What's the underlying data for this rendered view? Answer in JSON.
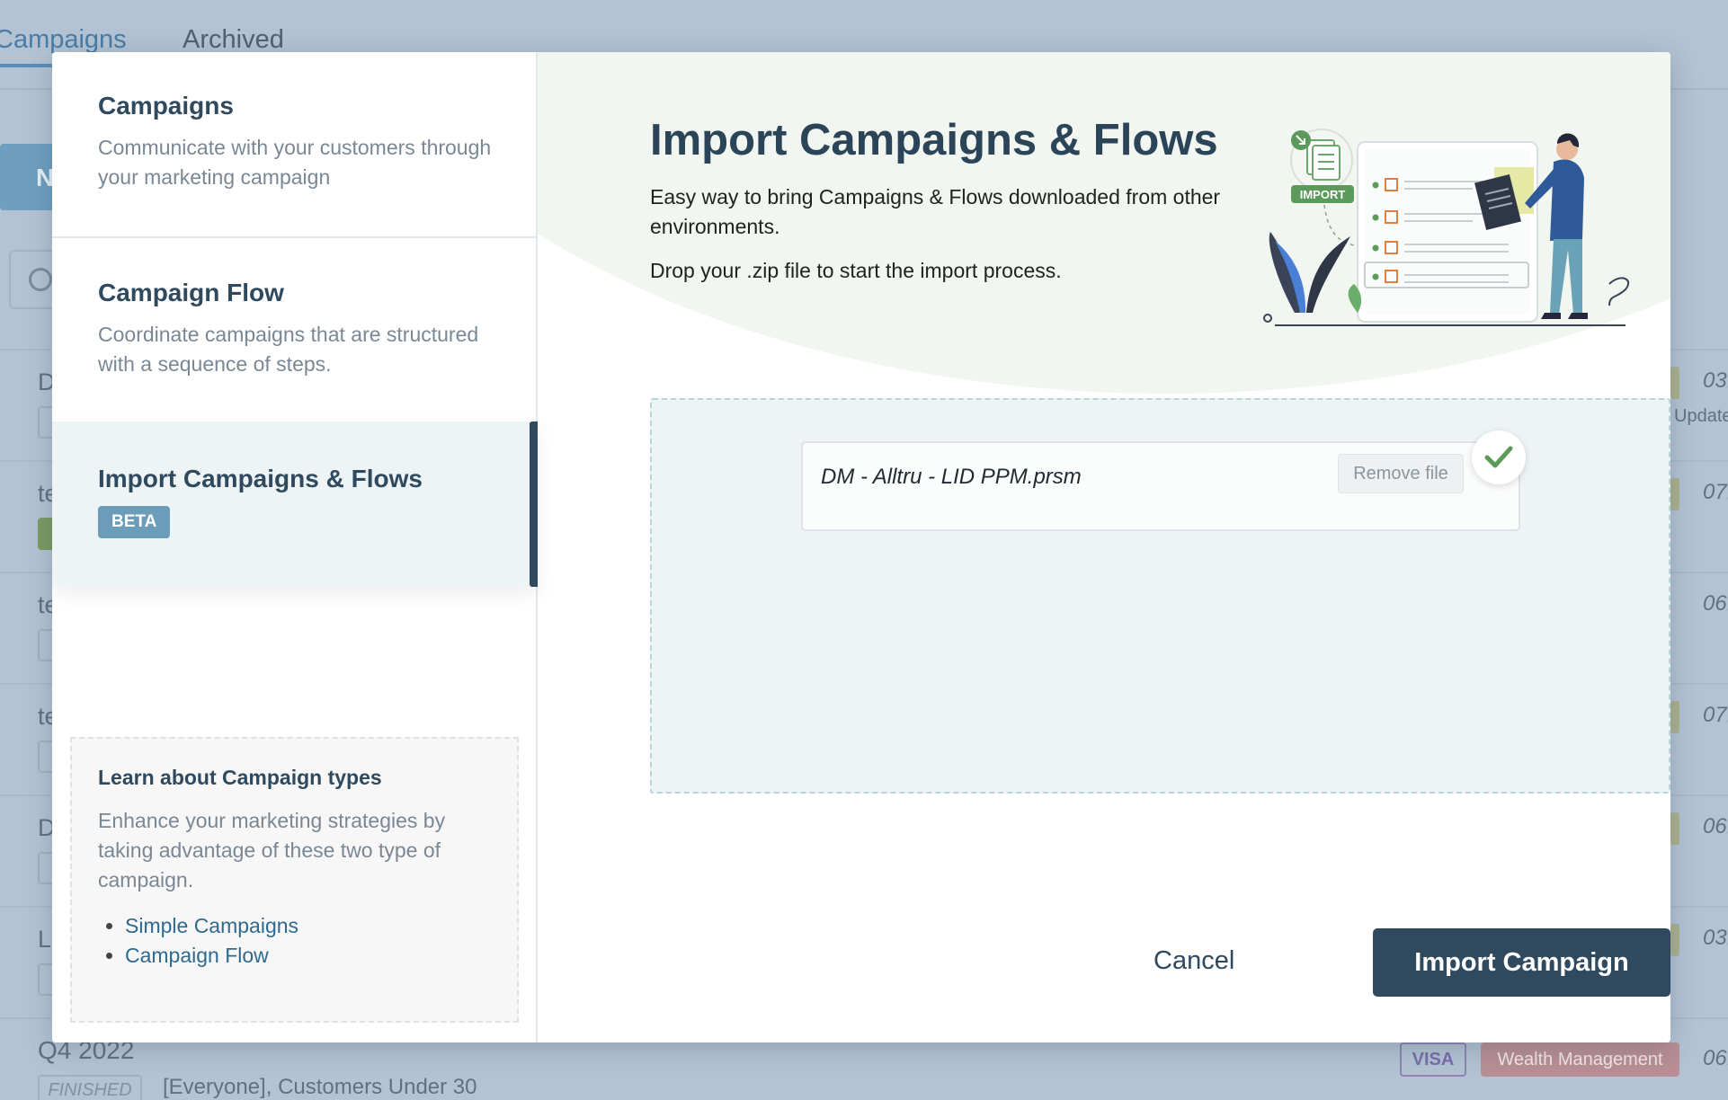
{
  "background": {
    "tabs": [
      "Campaigns",
      "Archived"
    ],
    "new_button_label": "N",
    "rows": [
      {
        "title_fragment": "D",
        "date_fragment": "03.",
        "updated_fragment": "Update"
      },
      {
        "title_fragment": "te",
        "date_fragment": "07."
      },
      {
        "title_fragment": "te",
        "date_fragment": "06."
      },
      {
        "title_fragment": "te",
        "date_fragment": "07."
      },
      {
        "title_fragment": "D",
        "date_fragment": "06."
      },
      {
        "title_fragment": "L",
        "date_fragment": "03."
      }
    ],
    "last_row": {
      "title": "Q4 2022",
      "status": "FINISHED",
      "audience": "[Everyone], Customers Under 30",
      "tags": [
        "VISA",
        "Wealth Management"
      ],
      "date_fragment": "06."
    }
  },
  "sidebar": {
    "items": [
      {
        "title": "Campaigns",
        "description": "Communicate with your customers through your marketing campaign"
      },
      {
        "title": "Campaign Flow",
        "description": "Coordinate campaigns that are structured with a sequence of steps."
      },
      {
        "title": "Import Campaigns & Flows",
        "badge": "BETA"
      }
    ],
    "learn": {
      "title": "Learn about Campaign types",
      "description": "Enhance your marketing strategies by taking advantage of these two type of campaign.",
      "links": [
        "Simple Campaigns",
        "Campaign Flow"
      ]
    }
  },
  "main": {
    "title": "Import Campaigns & Flows",
    "description": "Easy way to bring Campaigns & Flows downloaded from other environments.",
    "drop_hint": "Drop your .zip file to start the import process.",
    "illustration_badge": "IMPORT",
    "file": {
      "name": "DM - Alltru - LID PPM.prsm",
      "remove_label": "Remove file"
    },
    "cancel_label": "Cancel",
    "import_label": "Import Campaign"
  },
  "colors": {
    "primary": "#2f4a5e",
    "beta_badge": "#6b9cb8",
    "success": "#5b9a5b",
    "overlay": "#b3c3d3"
  }
}
